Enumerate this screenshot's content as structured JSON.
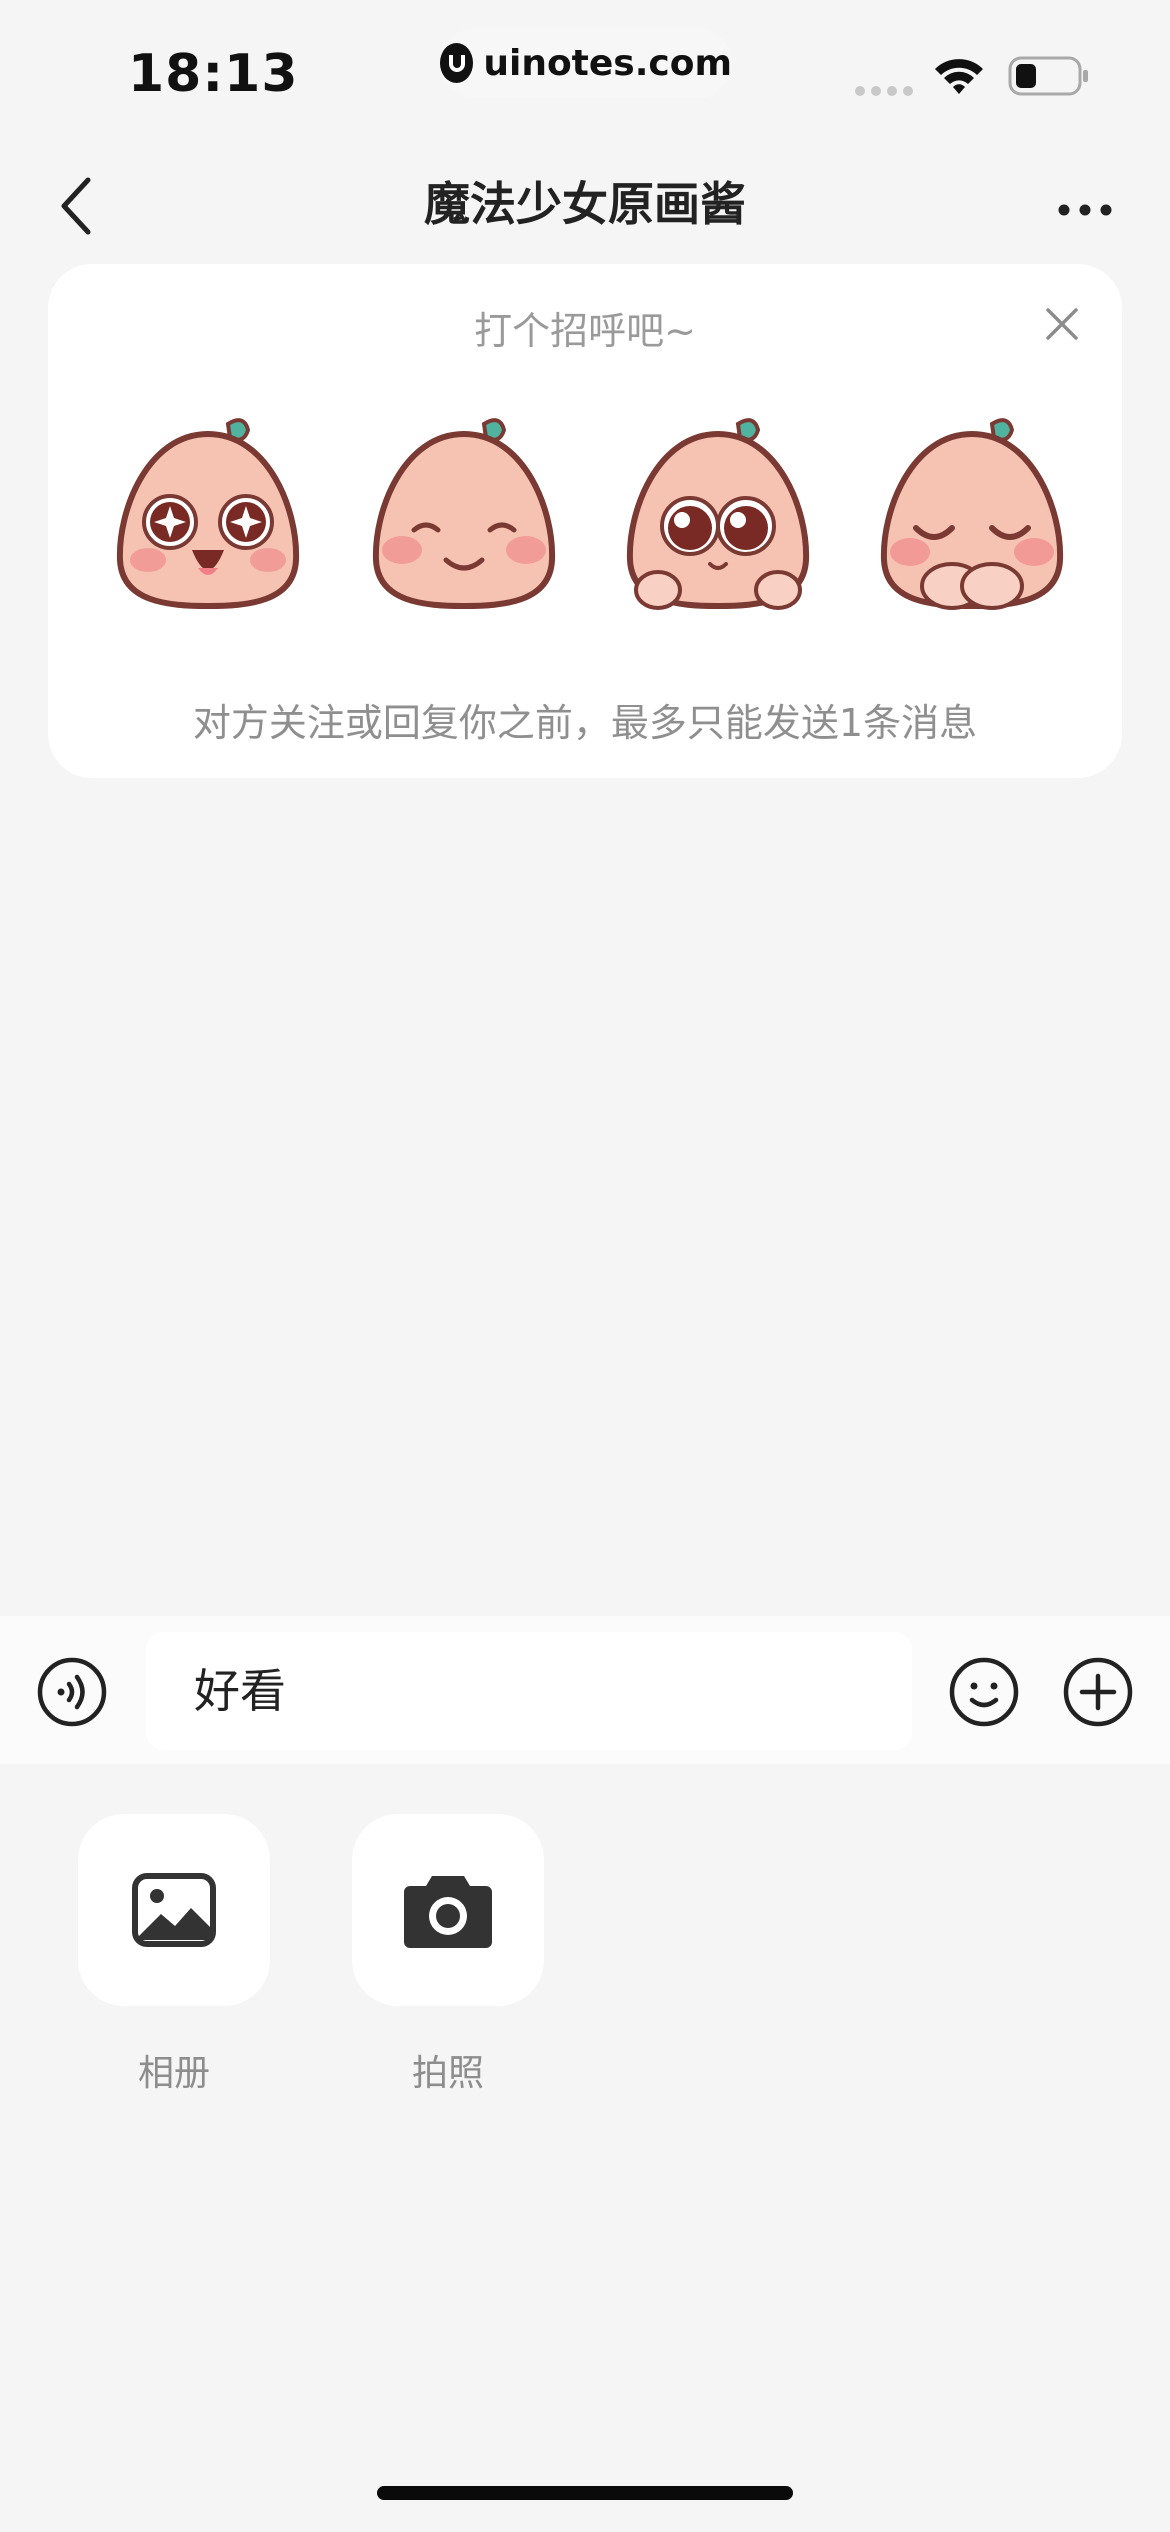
{
  "status_bar": {
    "time": "18:13",
    "watermark": "uinotes.com"
  },
  "nav": {
    "title": "魔法少女原画酱"
  },
  "greeting": {
    "title": "打个招呼吧~",
    "note": "对方关注或回复你之前，最多只能发送1条消息",
    "stickers": [
      "sticker-starry-eyes",
      "sticker-smile",
      "sticker-big-eyes",
      "sticker-shy"
    ]
  },
  "input": {
    "value": "好看"
  },
  "panel": {
    "items": [
      {
        "label": "相册",
        "icon": "album-icon"
      },
      {
        "label": "拍照",
        "icon": "camera-icon"
      }
    ]
  },
  "colors": {
    "background": "#f5f5f5",
    "card": "#ffffff",
    "sticker_body": "#f6c3b3",
    "sticker_outline": "#7a3a33",
    "sticker_leaf": "#4fb3a0"
  }
}
